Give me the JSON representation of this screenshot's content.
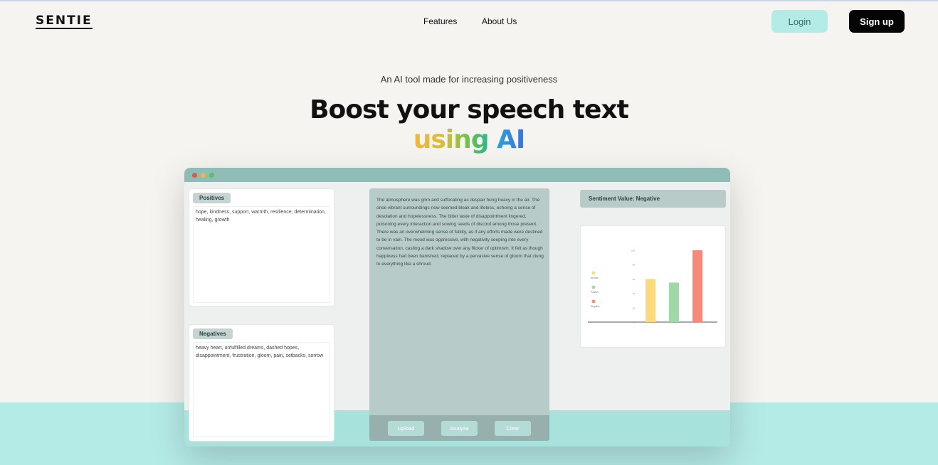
{
  "brand": {
    "logo": "SENTIE"
  },
  "nav": {
    "features": "Features",
    "about": "About Us",
    "login": "Login",
    "signup": "Sign up"
  },
  "hero": {
    "tagline": "An AI tool made for increasing positiveness",
    "headline_line1": "Boost your speech text",
    "headline_using": "using",
    "headline_ai": "AI"
  },
  "colors": {
    "accent_mint": "#b5ebe7",
    "titlebar": "#8fbcb7",
    "dot_red": "#e5534b",
    "dot_yellow": "#f0b93a",
    "dot_green": "#5cc15a"
  },
  "app": {
    "positives": {
      "label": "Positives",
      "text": "hope, kindness, support, warmth, resilience, determination, healing, growth"
    },
    "negatives": {
      "label": "Negatives",
      "text": "heavy heart, unfulfilled dreams, dashed hopes, disappointment, frustration, gloom, pain, setbacks, sorrow"
    },
    "speech_text": "The atmosphere was grim and suffocating as despair hung heavy in the air. The once vibrant surroundings now seemed bleak and lifeless, echoing a sense of desolation and hopelessness. The bitter taste of disappointment lingered, poisoning every interaction and sowing seeds of discord among those present. There was an overwhelming sense of futility, as if any efforts made were destined to be in vain. The mood was oppressive, with negativity seeping into every conversation, casting a dark shadow over any flicker of optimism. It felt as though happiness had been banished, replaced by a pervasive sense of gloom that clung to everything like a shroud.",
    "buttons": {
      "upload": "Upload",
      "analyse": "Analyse",
      "clear": "Clear"
    },
    "sentiment_label": "Sentiment Value: Negative"
  },
  "chart_data": {
    "type": "bar",
    "categories": [
      "Neutral",
      "Positive",
      "Negative"
    ],
    "series": [
      {
        "values": [
          60,
          55,
          100
        ]
      }
    ],
    "colors": [
      "#fbd97c",
      "#9fd9a8",
      "#f7897a"
    ],
    "legend": [
      "Neutral",
      "Positive",
      "Negative"
    ],
    "legend_position": "left",
    "ylim": [
      0,
      100
    ],
    "yticks": [
      0,
      20,
      40,
      60,
      80,
      100
    ],
    "title": "",
    "xlabel": "",
    "ylabel": ""
  }
}
